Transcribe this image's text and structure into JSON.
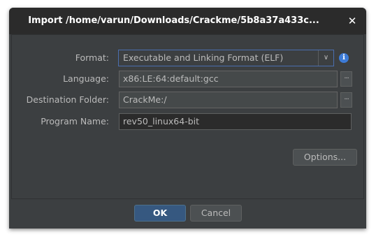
{
  "window": {
    "title": "Import /home/varun/Downloads/Crackme/5b8a37a433c...",
    "close_glyph": "✕"
  },
  "form": {
    "format": {
      "label": "Format:",
      "value": "Executable and Linking Format (ELF)",
      "arrow": "∨",
      "info_glyph": "i"
    },
    "language": {
      "label": "Language:",
      "value": "x86:LE:64:default:gcc",
      "browse_label": "..."
    },
    "destination": {
      "label": "Destination Folder:",
      "value": "CrackMe:/",
      "browse_label": "..."
    },
    "program_name": {
      "label": "Program Name:",
      "value": "rev50_linux64-bit"
    },
    "options_label": "Options..."
  },
  "buttons": {
    "ok": "OK",
    "cancel": "Cancel"
  },
  "colors": {
    "background": "#3c3f41",
    "titlebar": "#2b2b2b",
    "accent": "#365880",
    "info": "#3d7bd6"
  }
}
